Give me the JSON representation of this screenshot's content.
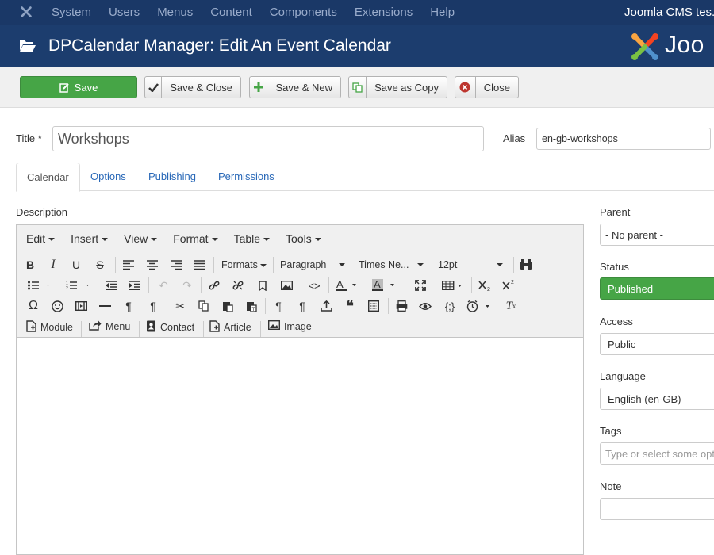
{
  "topnav": {
    "menu": [
      "System",
      "Users",
      "Menus",
      "Content",
      "Components",
      "Extensions",
      "Help"
    ],
    "site_name": "Joomla CMS tes..."
  },
  "header": {
    "title": "DPCalendar Manager: Edit An Event Calendar",
    "brand": "Joo"
  },
  "toolbar": {
    "save": "Save",
    "save_close": "Save & Close",
    "save_new": "Save & New",
    "save_copy": "Save as Copy",
    "close": "Close"
  },
  "form": {
    "title_label": "Title *",
    "title_value": "Workshops",
    "alias_label": "Alias",
    "alias_value": "en-gb-workshops"
  },
  "tabs": [
    "Calendar",
    "Options",
    "Publishing",
    "Permissions"
  ],
  "description_label": "Description",
  "editor": {
    "menus": [
      "Edit",
      "Insert",
      "View",
      "Format",
      "Table",
      "Tools"
    ],
    "formats": "Formats",
    "block": "Paragraph",
    "font": "Times Ne...",
    "size": "12pt",
    "buttons": [
      "Module",
      "Menu",
      "Contact",
      "Article",
      "Image"
    ]
  },
  "sidebar": {
    "parent_label": "Parent",
    "parent_value": "- No parent -",
    "status_label": "Status",
    "status_value": "Published",
    "access_label": "Access",
    "access_value": "Public",
    "language_label": "Language",
    "language_value": "English (en-GB)",
    "tags_label": "Tags",
    "tags_placeholder": "Type or select some opt",
    "note_label": "Note",
    "note_value": ""
  },
  "colors": {
    "topnav": "#1a3867",
    "header": "#1c3d6e",
    "save": "#46a546",
    "link": "#2a69b8"
  }
}
